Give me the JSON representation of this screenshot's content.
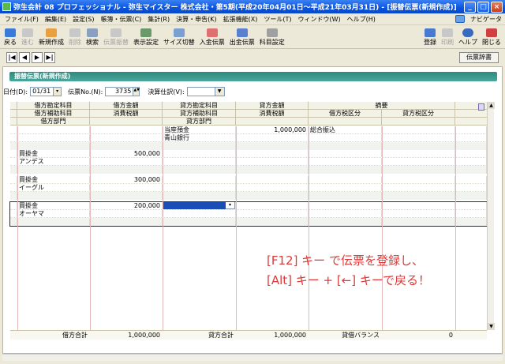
{
  "window": {
    "title": "弥生会計 08 プロフェッショナル - 弥生マイスター 株式会社・第5期(平成20年04月01日～平成21年03月31日) - [振替伝票(新規作成)]",
    "buttons": [
      "_",
      "□",
      "×"
    ]
  },
  "menu": {
    "items": [
      "ファイル(F)",
      "編集(E)",
      "設定(S)",
      "帳簿・伝票(C)",
      "集計(R)",
      "決算・申告(K)",
      "拡張機能(X)",
      "ツール(T)",
      "ウィンドウ(W)",
      "ヘルプ(H)"
    ],
    "navi_label": "ナビゲータ"
  },
  "toolbar": {
    "left": [
      {
        "label": "戻る",
        "disabled": false,
        "icon": "back-arrow-icon"
      },
      {
        "label": "進む",
        "disabled": true,
        "icon": "forward-arrow-icon"
      },
      {
        "label": "新規作成",
        "disabled": false,
        "icon": "new-doc-icon"
      },
      {
        "label": "削除",
        "disabled": true,
        "icon": "delete-icon"
      },
      {
        "label": "検索",
        "disabled": false,
        "icon": "search-icon"
      },
      {
        "label": "伝票振替",
        "disabled": true,
        "icon": "transfer-icon"
      },
      {
        "label": "表示設定",
        "disabled": false,
        "icon": "display-settings-icon"
      },
      {
        "label": "サイズ切替",
        "disabled": false,
        "icon": "resize-icon"
      },
      {
        "label": "入金伝票",
        "disabled": false,
        "icon": "receipt-slip-icon"
      },
      {
        "label": "出金伝票",
        "disabled": false,
        "icon": "payment-slip-icon"
      },
      {
        "label": "科目設定",
        "disabled": false,
        "icon": "account-settings-icon"
      }
    ],
    "right": [
      {
        "label": "登録",
        "disabled": false,
        "icon": "register-icon"
      },
      {
        "label": "印刷",
        "disabled": true,
        "icon": "print-icon"
      },
      {
        "label": "ヘルプ",
        "disabled": false,
        "icon": "help-icon"
      },
      {
        "label": "閉じる",
        "disabled": false,
        "icon": "close-window-icon"
      }
    ]
  },
  "nav": {
    "buttons": [
      "|◀",
      "◀",
      "▶",
      "▶|"
    ],
    "dictionary_button": "伝票辞書"
  },
  "form": {
    "heading": "振替伝票(新規作成)",
    "date_label": "日付(D):",
    "date_value": "01/31",
    "slip_no_label": "伝票No.(N):",
    "slip_no_value": "3735",
    "closing_label": "決算仕訳(V):",
    "closing_value": ""
  },
  "grid": {
    "headers_row1": [
      "借方勘定科目",
      "借方金額",
      "貸方勘定科目",
      "貸方金額",
      "摘要"
    ],
    "headers_row2": [
      "借方補助科目",
      "消費税額",
      "貸方補助科目",
      "消費税額",
      "借方税区分",
      "貸方税区分"
    ],
    "headers_row3": [
      "借方部門",
      "",
      "貸方部門"
    ],
    "entries": [
      {
        "debit_account": "",
        "debit_sub": "",
        "debit_amount": "",
        "credit_account": "当座預金",
        "credit_sub": "青山銀行",
        "credit_amount": "1,000,000",
        "memo": "総合振込"
      },
      {
        "debit_account": "買掛金",
        "debit_sub": "アンデス",
        "debit_amount": "500,000",
        "credit_account": "",
        "credit_sub": "",
        "credit_amount": "",
        "memo": ""
      },
      {
        "debit_account": "買掛金",
        "debit_sub": "イーグル",
        "debit_amount": "300,000",
        "credit_account": "",
        "credit_sub": "",
        "credit_amount": "",
        "memo": ""
      },
      {
        "debit_account": "買掛金",
        "debit_sub": "オーヤマ",
        "debit_amount": "200,000",
        "credit_account": "",
        "credit_sub": "",
        "credit_amount": "",
        "memo": ""
      }
    ]
  },
  "totals": {
    "debit_label": "借方合計",
    "debit_value": "1,000,000",
    "credit_label": "貸方合計",
    "credit_value": "1,000,000",
    "balance_label": "貸借バランス",
    "balance_value": "0"
  },
  "overlay": {
    "line1": "[F12] キー で伝票を登録し、",
    "line2": "[Alt] キー + [←] キーで戻る！"
  }
}
